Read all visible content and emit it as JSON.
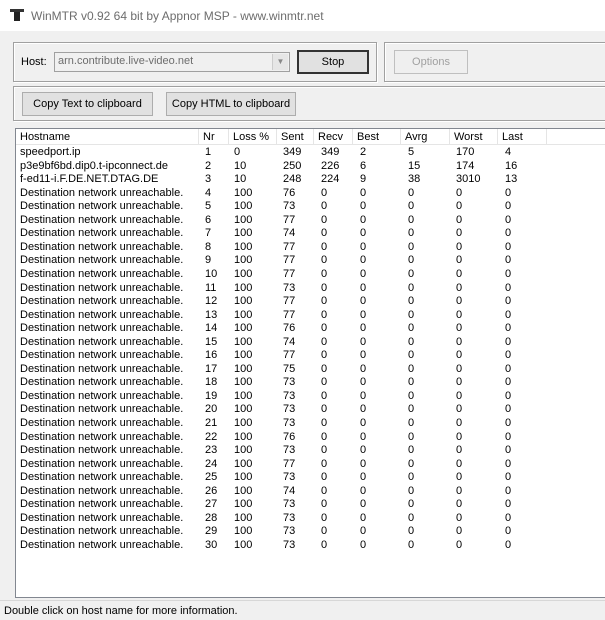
{
  "window": {
    "title": "WinMTR v0.92 64 bit by Appnor MSP - www.winmtr.net",
    "icon": "winmtr-app-icon"
  },
  "host": {
    "label": "Host:",
    "value": "arn.contribute.live-video.net"
  },
  "buttons": {
    "stop": "Stop",
    "options": "Options",
    "copy_text": "Copy Text to clipboard",
    "copy_html": "Copy HTML to clipboard"
  },
  "columns": [
    "Hostname",
    "Nr",
    "Loss %",
    "Sent",
    "Recv",
    "Best",
    "Avrg",
    "Worst",
    "Last"
  ],
  "rows": [
    [
      "speedport.ip",
      "1",
      "0",
      "349",
      "349",
      "2",
      "5",
      "170",
      "4"
    ],
    [
      "p3e9bf6bd.dip0.t-ipconnect.de",
      "2",
      "10",
      "250",
      "226",
      "6",
      "15",
      "174",
      "16"
    ],
    [
      "f-ed11-i.F.DE.NET.DTAG.DE",
      "3",
      "10",
      "248",
      "224",
      "9",
      "38",
      "3010",
      "13"
    ],
    [
      "Destination network unreachable.",
      "4",
      "100",
      "76",
      "0",
      "0",
      "0",
      "0",
      "0"
    ],
    [
      "Destination network unreachable.",
      "5",
      "100",
      "73",
      "0",
      "0",
      "0",
      "0",
      "0"
    ],
    [
      "Destination network unreachable.",
      "6",
      "100",
      "77",
      "0",
      "0",
      "0",
      "0",
      "0"
    ],
    [
      "Destination network unreachable.",
      "7",
      "100",
      "74",
      "0",
      "0",
      "0",
      "0",
      "0"
    ],
    [
      "Destination network unreachable.",
      "8",
      "100",
      "77",
      "0",
      "0",
      "0",
      "0",
      "0"
    ],
    [
      "Destination network unreachable.",
      "9",
      "100",
      "77",
      "0",
      "0",
      "0",
      "0",
      "0"
    ],
    [
      "Destination network unreachable.",
      "10",
      "100",
      "77",
      "0",
      "0",
      "0",
      "0",
      "0"
    ],
    [
      "Destination network unreachable.",
      "11",
      "100",
      "73",
      "0",
      "0",
      "0",
      "0",
      "0"
    ],
    [
      "Destination network unreachable.",
      "12",
      "100",
      "77",
      "0",
      "0",
      "0",
      "0",
      "0"
    ],
    [
      "Destination network unreachable.",
      "13",
      "100",
      "77",
      "0",
      "0",
      "0",
      "0",
      "0"
    ],
    [
      "Destination network unreachable.",
      "14",
      "100",
      "76",
      "0",
      "0",
      "0",
      "0",
      "0"
    ],
    [
      "Destination network unreachable.",
      "15",
      "100",
      "74",
      "0",
      "0",
      "0",
      "0",
      "0"
    ],
    [
      "Destination network unreachable.",
      "16",
      "100",
      "77",
      "0",
      "0",
      "0",
      "0",
      "0"
    ],
    [
      "Destination network unreachable.",
      "17",
      "100",
      "75",
      "0",
      "0",
      "0",
      "0",
      "0"
    ],
    [
      "Destination network unreachable.",
      "18",
      "100",
      "73",
      "0",
      "0",
      "0",
      "0",
      "0"
    ],
    [
      "Destination network unreachable.",
      "19",
      "100",
      "73",
      "0",
      "0",
      "0",
      "0",
      "0"
    ],
    [
      "Destination network unreachable.",
      "20",
      "100",
      "73",
      "0",
      "0",
      "0",
      "0",
      "0"
    ],
    [
      "Destination network unreachable.",
      "21",
      "100",
      "73",
      "0",
      "0",
      "0",
      "0",
      "0"
    ],
    [
      "Destination network unreachable.",
      "22",
      "100",
      "76",
      "0",
      "0",
      "0",
      "0",
      "0"
    ],
    [
      "Destination network unreachable.",
      "23",
      "100",
      "73",
      "0",
      "0",
      "0",
      "0",
      "0"
    ],
    [
      "Destination network unreachable.",
      "24",
      "100",
      "77",
      "0",
      "0",
      "0",
      "0",
      "0"
    ],
    [
      "Destination network unreachable.",
      "25",
      "100",
      "73",
      "0",
      "0",
      "0",
      "0",
      "0"
    ],
    [
      "Destination network unreachable.",
      "26",
      "100",
      "74",
      "0",
      "0",
      "0",
      "0",
      "0"
    ],
    [
      "Destination network unreachable.",
      "27",
      "100",
      "73",
      "0",
      "0",
      "0",
      "0",
      "0"
    ],
    [
      "Destination network unreachable.",
      "28",
      "100",
      "73",
      "0",
      "0",
      "0",
      "0",
      "0"
    ],
    [
      "Destination network unreachable.",
      "29",
      "100",
      "73",
      "0",
      "0",
      "0",
      "0",
      "0"
    ],
    [
      "Destination network unreachable.",
      "30",
      "100",
      "73",
      "0",
      "0",
      "0",
      "0",
      "0"
    ]
  ],
  "status": "Double click on host name for more information."
}
